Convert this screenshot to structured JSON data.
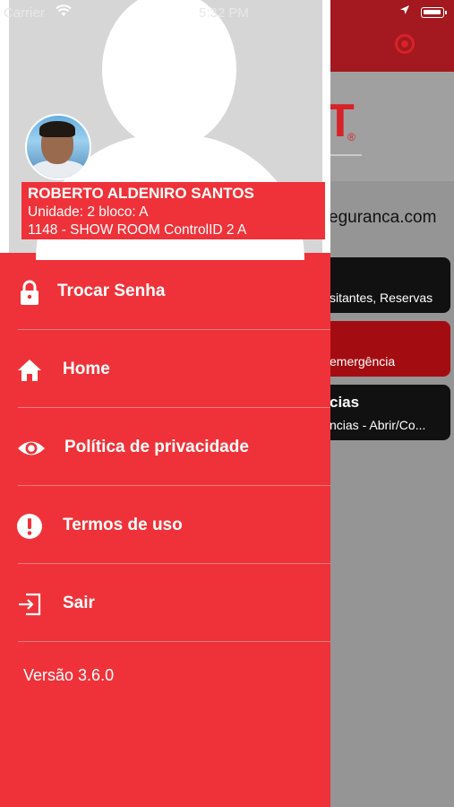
{
  "status_bar": {
    "carrier": "Carrier",
    "time": "5:32 PM"
  },
  "background_screen": {
    "email_fragment": "eguranca.com",
    "logo_fragment": "T",
    "cards": [
      {
        "title": "",
        "subtitle": "sitantes, Reservas",
        "color": "#111111"
      },
      {
        "title": "",
        "subtitle": "emergência",
        "color": "#a30d12"
      },
      {
        "title": "cias",
        "subtitle": "ncias - Abrir/Co...",
        "color": "#111111"
      }
    ]
  },
  "profile": {
    "name": "ROBERTO ALDENIRO SANTOS",
    "unit": "Unidade: 2 bloco: A",
    "place": "1148 - SHOW ROOM ControlID 2 A"
  },
  "menu": {
    "items": [
      {
        "label": "Trocar Senha",
        "icon": "lock-icon"
      },
      {
        "label": "Home",
        "icon": "home-icon"
      },
      {
        "label": "Política de privacidade",
        "icon": "eye-icon"
      },
      {
        "label": "Termos de uso",
        "icon": "exclamation-icon"
      },
      {
        "label": "Sair",
        "icon": "logout-icon"
      }
    ]
  },
  "version": "Versão 3.6.0",
  "colors": {
    "drawer_red": "#ef3239",
    "header_dark_red": "#a3191f"
  }
}
